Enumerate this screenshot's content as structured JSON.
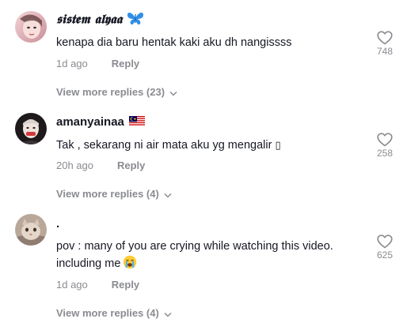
{
  "comments": [
    {
      "username": "𝖘𝖎𝖘𝖙𝖊𝖒 𝖆𝖑𝖞𝖆𝖆",
      "username_suffix_icon": "butterfly-icon",
      "text": "kenapa dia baru hentak kaki aku dh nangissss",
      "time": "1d ago",
      "reply_label": "Reply",
      "likes": "748",
      "view_more": "View more replies (23)"
    },
    {
      "username": "amanyainaa",
      "username_suffix_icon": "malaysia-flag-icon",
      "text": "Tak , sekarang ni air mata aku yg mengalir ",
      "text_trailing_glyph": "▯",
      "time": "20h ago",
      "reply_label": "Reply",
      "likes": "258",
      "view_more": "View more replies (4)"
    },
    {
      "username": ".",
      "text": "pov : many of you are crying while watching this video. including me",
      "text_trailing_icon": "crying-face-emoji-icon",
      "time": "1d ago",
      "reply_label": "Reply",
      "likes": "625",
      "view_more": "View more replies (4)"
    }
  ],
  "colors": {
    "text_primary": "#161823",
    "text_secondary": "#8a8b91",
    "butterfly": "#2f8fe8"
  }
}
